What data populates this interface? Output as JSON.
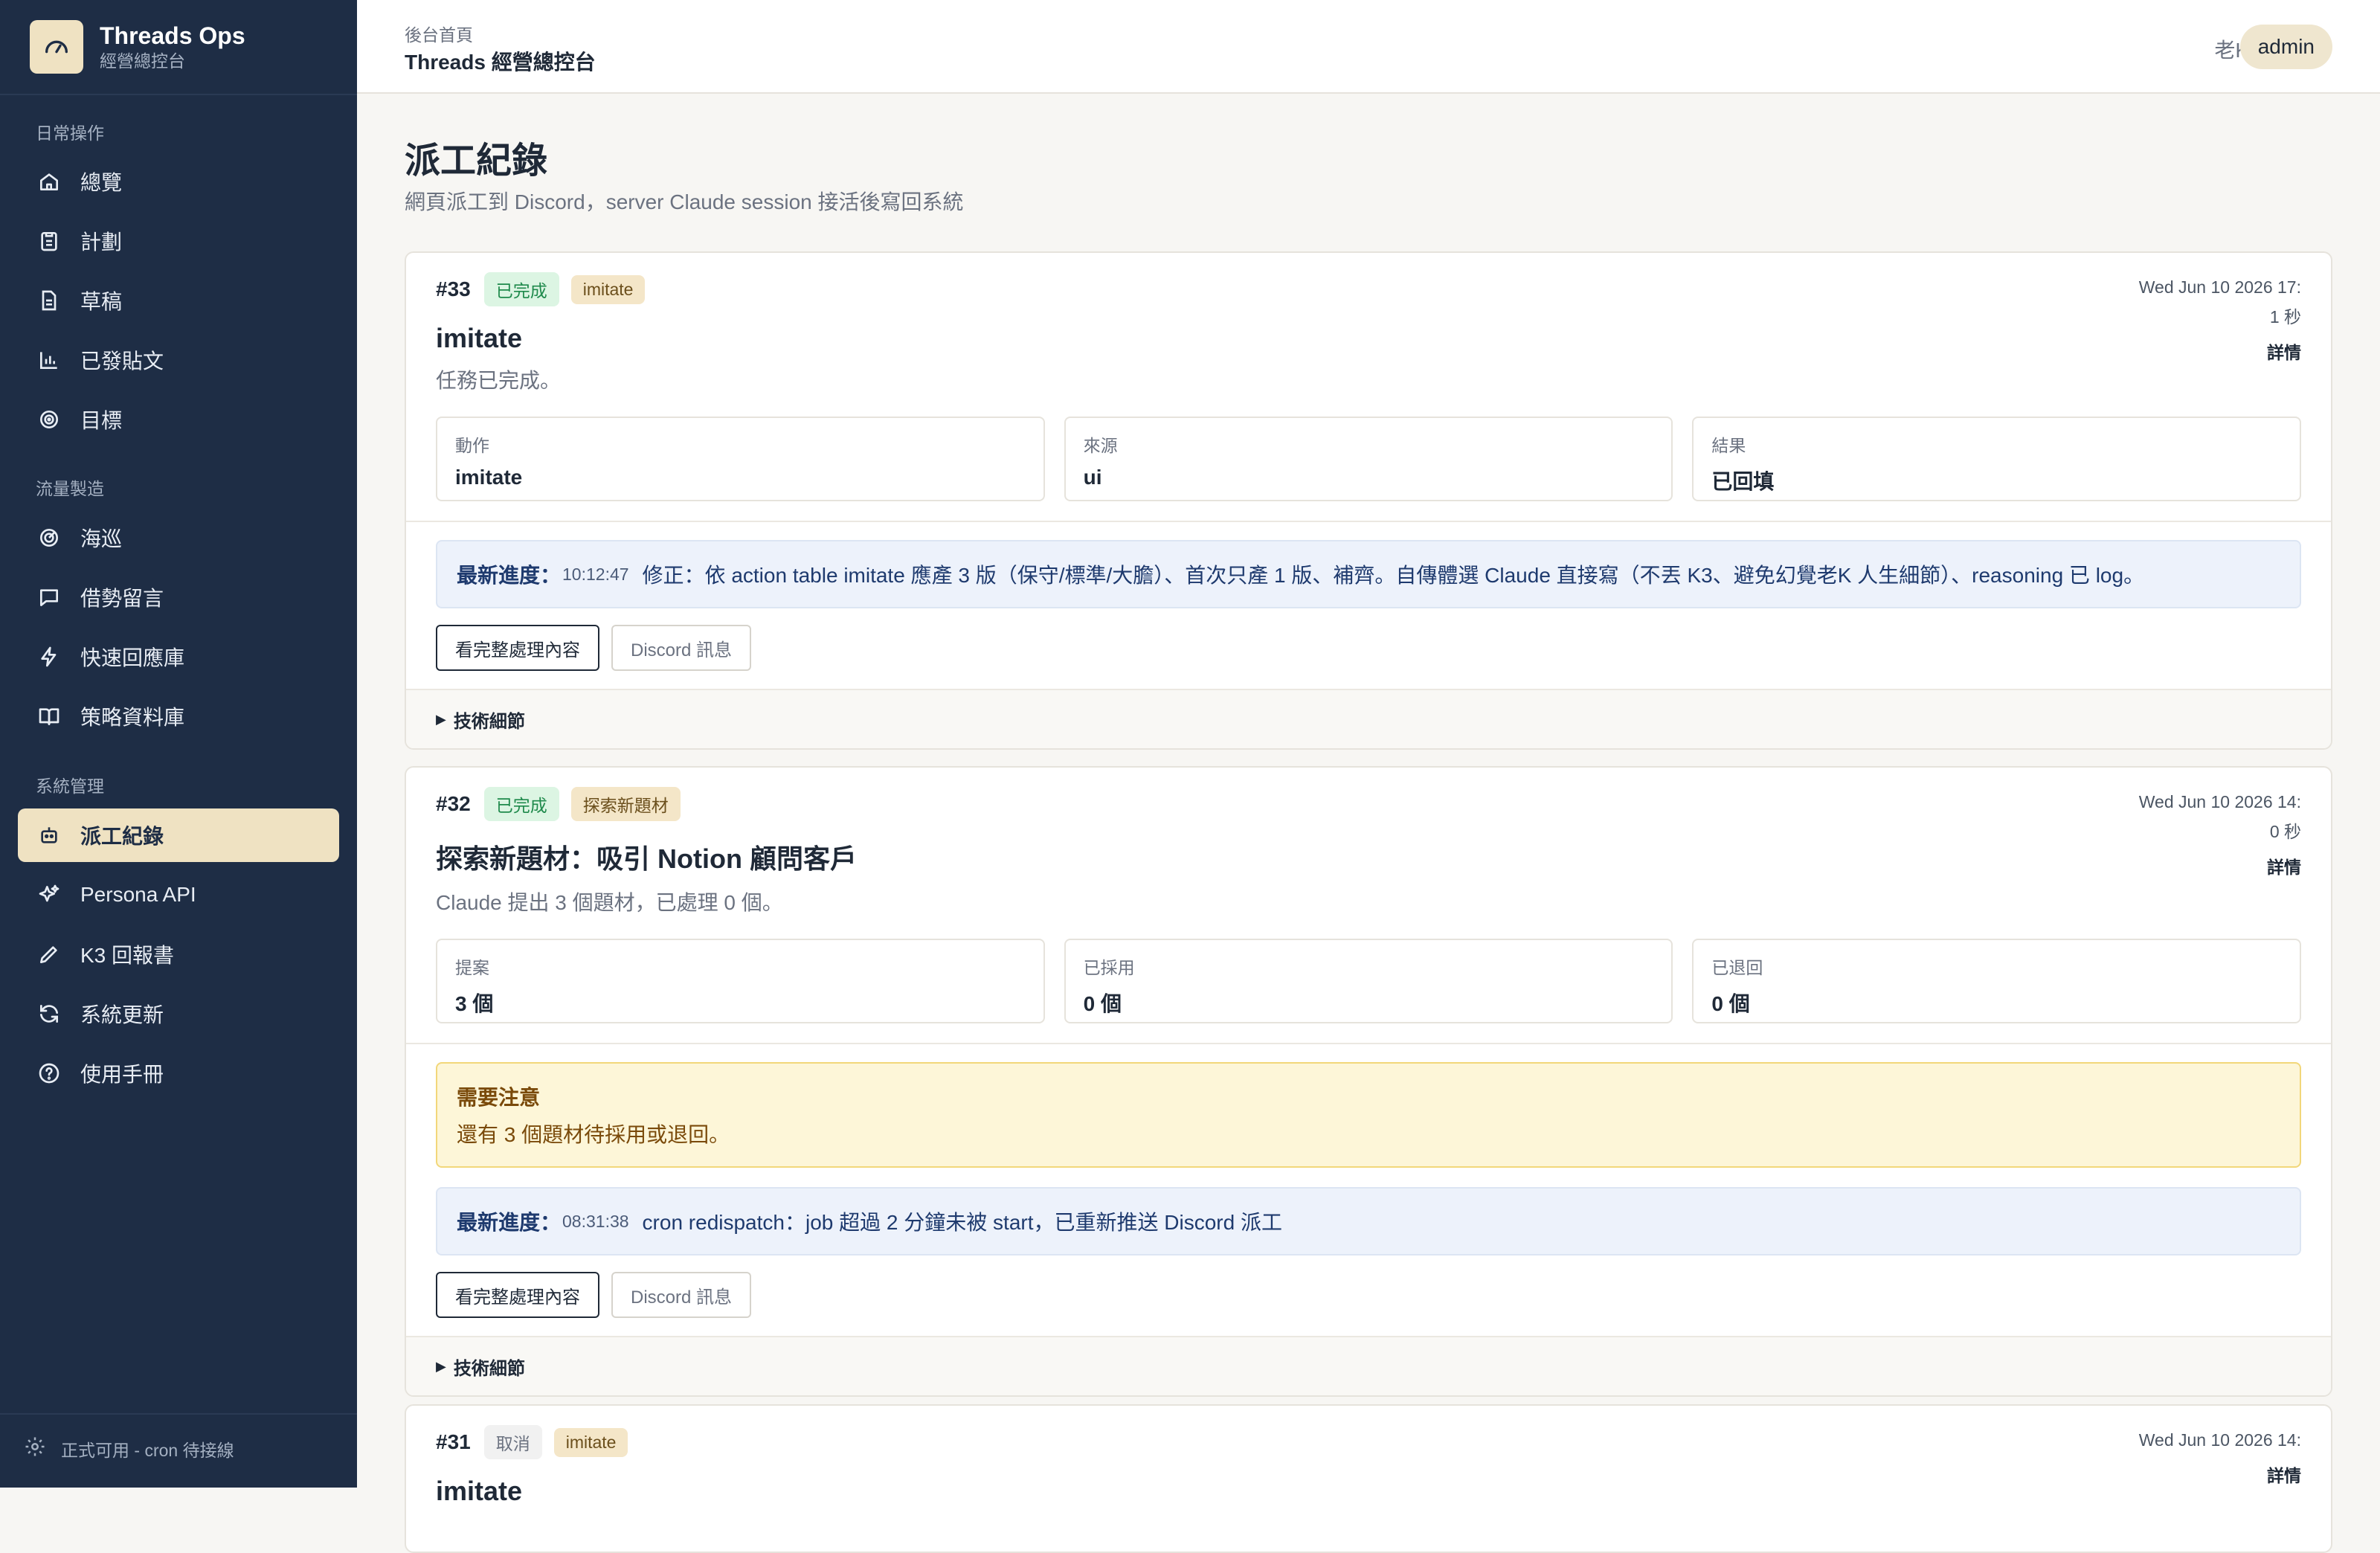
{
  "brand": {
    "title": "Threads Ops",
    "subtitle": "經營總控台"
  },
  "sidebar": {
    "sections": [
      {
        "label": "日常操作"
      },
      {
        "label": "流量製造"
      },
      {
        "label": "系統管理"
      }
    ],
    "items": [
      {
        "label": "總覽",
        "icon": "home-icon"
      },
      {
        "label": "計劃",
        "icon": "clipboard-icon"
      },
      {
        "label": "草稿",
        "icon": "document-icon"
      },
      {
        "label": "已發貼文",
        "icon": "bar-chart-icon"
      },
      {
        "label": "目標",
        "icon": "target-icon"
      },
      {
        "label": "海巡",
        "icon": "radar-icon"
      },
      {
        "label": "借勢留言",
        "icon": "message-icon"
      },
      {
        "label": "快速回應庫",
        "icon": "lightning-icon"
      },
      {
        "label": "策略資料庫",
        "icon": "book-icon"
      },
      {
        "label": "派工紀錄",
        "icon": "robot-icon",
        "active": true
      },
      {
        "label": "Persona API",
        "icon": "sparkles-icon"
      },
      {
        "label": "K3 回報書",
        "icon": "pen-icon"
      },
      {
        "label": "系統更新",
        "icon": "refresh-icon"
      },
      {
        "label": "使用手冊",
        "icon": "help-circle-icon"
      }
    ],
    "footer": "正式可用 - cron 待接線"
  },
  "topbar": {
    "breadcrumb": "後台首頁",
    "title": "Threads 經營總控台",
    "user": "老K",
    "role": "admin"
  },
  "page": {
    "title": "派工紀錄",
    "subtitle": "網頁派工到 Discord，server Claude session 接活後寫回系統"
  },
  "common": {
    "detail_link": "詳情",
    "progress_label": "最新進度：",
    "view_full_button": "看完整處理內容",
    "discord_button": "Discord 訊息",
    "tech_details": "技術細節"
  },
  "jobs": [
    {
      "id": "#33",
      "status": "已完成",
      "type": "imitate",
      "time": "Wed Jun 10 2026 17:",
      "duration": "1 秒",
      "title": "imitate",
      "message": "任務已完成。",
      "stats": [
        {
          "label": "動作",
          "value": "imitate"
        },
        {
          "label": "來源",
          "value": "ui"
        },
        {
          "label": "結果",
          "value": "已回填"
        }
      ],
      "progress_time": "10:12:47",
      "progress_text": "修正：依 action table imitate 應產 3 版（保守/標準/大膽）、首次只產 1 版、補齊。自傳體選 Claude 直接寫（不丟 K3、避免幻覺老K 人生細節）、reasoning 已 log。"
    },
    {
      "id": "#32",
      "status": "已完成",
      "type": "探索新題材",
      "time": "Wed Jun 10 2026 14:",
      "duration": "0 秒",
      "title": "探索新題材：吸引 Notion 顧問客戶",
      "message": "Claude 提出 3 個題材，已處理 0 個。",
      "stats": [
        {
          "label": "提案",
          "value": "3 個"
        },
        {
          "label": "已採用",
          "value": "0 個"
        },
        {
          "label": "已退回",
          "value": "0 個"
        }
      ],
      "warning_title": "需要注意",
      "warning_text": "還有 3 個題材待採用或退回。",
      "progress_time": "08:31:38",
      "progress_text": "cron redispatch：job 超過 2 分鐘未被 start，已重新推送 Discord 派工"
    },
    {
      "id": "#31",
      "status": "取消",
      "type": "imitate",
      "time": "Wed Jun 10 2026 14:",
      "title": "imitate"
    }
  ]
}
